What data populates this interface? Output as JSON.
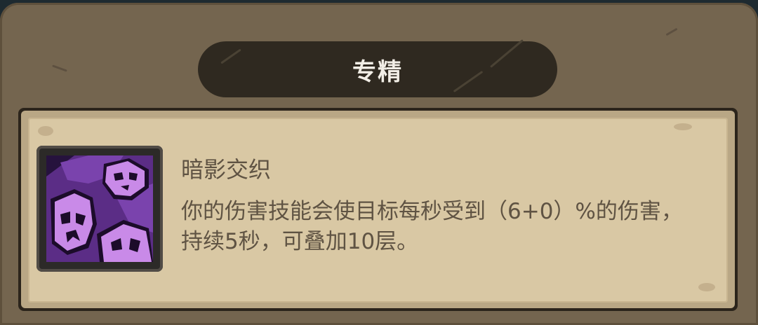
{
  "panel": {
    "title": "专精"
  },
  "skill": {
    "icon": "purple-skulls-icon",
    "name": "暗影交织",
    "description": "你的伤害技能会使目标每秒受到（6+0）%的伤害，持续5秒，可叠加10层。"
  },
  "colors": {
    "panel_bg": "#74654f",
    "banner_bg": "#2f2920",
    "card_bg": "#d9c8a4",
    "text": "#5f5343",
    "title_text": "#f2eee6",
    "icon_purple": "#b06bd6"
  }
}
